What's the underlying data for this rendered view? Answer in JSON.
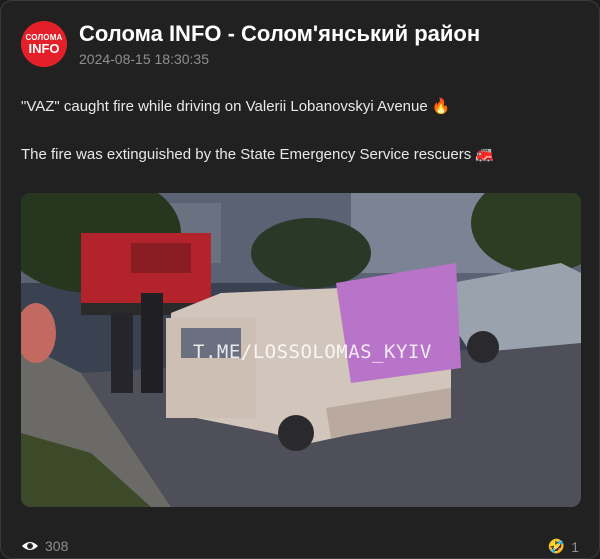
{
  "channel": {
    "name": "Солома INFO - Солом'янський район",
    "avatar_line1": "СОЛОМА",
    "avatar_line2": "INFO",
    "avatar_color": "#e3202a"
  },
  "post": {
    "date": "2024-08-15 18:30:35",
    "line1": "\"VAZ\" caught fire while driving on Valerii Lobanovskyi Avenue 🔥",
    "line2": "The fire was extinguished by the State Emergency Service rescuers 🚒",
    "photo_watermark": "T.ME/LOSSOLOMAS_KYIV",
    "views": "308",
    "reaction_emoji": "🤣",
    "reaction_count": "1"
  },
  "icons": {
    "views": "eye-icon"
  }
}
